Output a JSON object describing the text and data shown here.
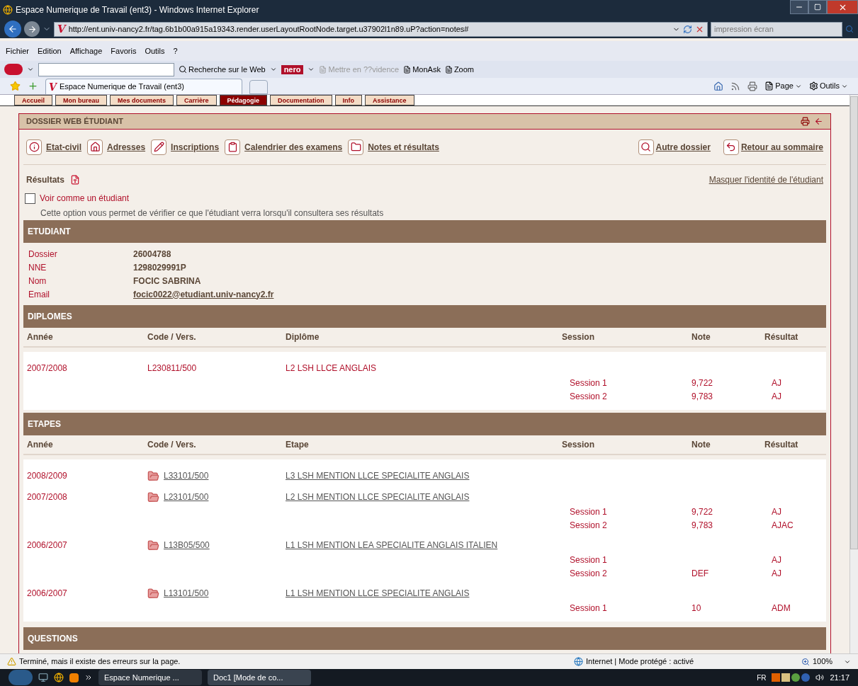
{
  "window": {
    "title": "Espace Numerique de Travail (ent3) - Windows Internet Explorer"
  },
  "address_bar": {
    "logo": "V",
    "url": "http://ent.univ-nancy2.fr/tag.6b1b00a915a19343.render.userLayoutRootNode.target.u37902l1n89.uP?action=notes#"
  },
  "search": {
    "placeholder": "impression écran"
  },
  "menu": [
    "Fichier",
    "Edition",
    "Affichage",
    "Favoris",
    "Outils",
    "?"
  ],
  "ask_toolbar": {
    "search_button": "Recherche sur le Web",
    "brand": "nero",
    "items": [
      {
        "label": "Mettre en ??vidence",
        "disabled": true
      },
      {
        "label": "MonAsk",
        "disabled": false
      },
      {
        "label": "Zoom",
        "disabled": false
      }
    ]
  },
  "tab": {
    "logo": "V",
    "title": "Espace Numerique de Travail (ent3)"
  },
  "command_bar": [
    "Page",
    "Outils"
  ],
  "site_nav": [
    {
      "label": "Accueil",
      "selected": false
    },
    {
      "label": "Mon bureau",
      "selected": false
    },
    {
      "label": "Mes documents",
      "selected": false
    },
    {
      "label": "Carrière",
      "selected": false
    },
    {
      "label": "Pédagogie",
      "selected": true
    },
    {
      "label": "Documentation",
      "selected": false
    },
    {
      "label": "Info",
      "selected": false
    },
    {
      "label": "Assistance",
      "selected": false
    }
  ],
  "panel": {
    "title": "DOSSIER WEB ÉTUDIANT",
    "links": [
      {
        "label": "Etat-civil",
        "kind": "info"
      },
      {
        "label": "Adresses",
        "kind": "house"
      },
      {
        "label": "Inscriptions",
        "kind": "pen"
      },
      {
        "label": "Calendrier des examens",
        "kind": "clipboard"
      },
      {
        "label": "Notes et résultats",
        "kind": "folder"
      }
    ],
    "right_links": [
      {
        "label": "Autre dossier",
        "kind": "search"
      },
      {
        "label": "Retour au sommaire",
        "kind": "back"
      }
    ],
    "results_label": "Résultats",
    "hide_identity": "Masquer l'identité de l'étudiant",
    "student_view": {
      "label": "Voir comme un étudiant",
      "checked": false,
      "help": "Cette option vous permet de vérifier ce que l'étudiant verra lorsqu'il consultera ses résultats"
    }
  },
  "student": {
    "title": "ETUDIANT",
    "fields": [
      {
        "label": "Dossier",
        "value": "26004788",
        "kind": "text"
      },
      {
        "label": "NNE",
        "value": "1298029991P",
        "kind": "text"
      },
      {
        "label": "Nom",
        "value": "FOCIC SABRINA",
        "kind": "text"
      },
      {
        "label": "Email",
        "value": "focic0022@etudiant.univ-nancy2.fr",
        "kind": "link"
      }
    ]
  },
  "diplomes": {
    "title": "DIPLOMES",
    "columns": [
      "Année",
      "Code / Vers.",
      "Diplôme",
      "Session",
      "Note",
      "Résultat"
    ],
    "rows": [
      {
        "year": "2007/2008",
        "code": "L230811/500",
        "label": "L2 LSH LLCE ANGLAIS",
        "kind": "text",
        "sessions": [
          {
            "session": "Session 1",
            "note": "9,722",
            "result": "AJ"
          },
          {
            "session": "Session 2",
            "note": "9,783",
            "result": "AJ"
          }
        ]
      }
    ]
  },
  "etapes": {
    "title": "ETAPES",
    "columns": [
      "Année",
      "Code / Vers.",
      "Etape",
      "Session",
      "Note",
      "Résultat"
    ],
    "rows": [
      {
        "year": "2008/2009",
        "code": "L33101/500",
        "label": "L3 LSH MENTION LLCE SPECIALITE ANGLAIS",
        "kind": "link",
        "sessions": []
      },
      {
        "year": "2007/2008",
        "code": "L23101/500",
        "label": "L2 LSH MENTION LLCE SPECIALITE ANGLAIS",
        "kind": "link",
        "sessions": [
          {
            "session": "Session 1",
            "note": "9,722",
            "result": "AJ"
          },
          {
            "session": "Session 2",
            "note": "9,783",
            "result": "AJAC"
          }
        ]
      },
      {
        "year": "2006/2007",
        "code": "L13B05/500",
        "label": "L1 LSH MENTION LEA SPECIALITE ANGLAIS ITALIEN",
        "kind": "link",
        "sessions": [
          {
            "session": "Session 1",
            "result": "AJ"
          },
          {
            "session": "Session 2",
            "note": "DEF",
            "result": "AJ"
          }
        ]
      },
      {
        "year": "2006/2007",
        "code": "L13101/500",
        "label": "L1 LSH MENTION LLCE SPECIALITE ANGLAIS",
        "kind": "link",
        "sessions": [
          {
            "session": "Session 1",
            "note": "10",
            "result": "ADM"
          }
        ]
      }
    ]
  },
  "questions": {
    "title": "QUESTIONS"
  },
  "status_bar": {
    "message": "Terminé, mais il existe des erreurs sur la page.",
    "zone": "Internet | Mode protégé : activé",
    "zoom": "100%"
  },
  "taskbar": {
    "windows": [
      {
        "label": "Espace Numerique ...",
        "selected": true
      },
      {
        "label": "Doc1 [Mode de co...",
        "selected": false
      }
    ],
    "language": "FR",
    "clock": "21:17"
  }
}
